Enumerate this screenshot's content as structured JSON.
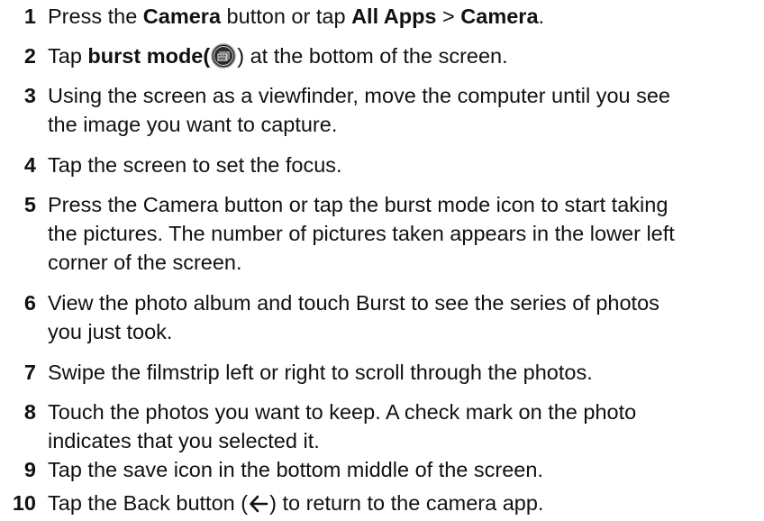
{
  "steps": [
    {
      "number": "1",
      "parts": {
        "a": "Press the ",
        "b": "Camera",
        "c": " button or tap ",
        "d": "All Apps",
        "e": " > ",
        "f": "Camera",
        "g": "."
      }
    },
    {
      "number": "2",
      "parts": {
        "a": "Tap ",
        "b": "burst mode",
        "c": "(",
        "d": ")",
        "e": " at the bottom of the screen."
      }
    },
    {
      "number": "3",
      "lines": [
        "Using the screen as a viewfinder, move the computer until you see",
        "the image you want to capture."
      ]
    },
    {
      "number": "4",
      "lines": [
        "Tap the screen to set the focus."
      ]
    },
    {
      "number": "5",
      "lines": [
        "Press the Camera button or tap the burst mode icon to start taking",
        "the pictures. The number of pictures taken appears in the lower left",
        "corner of the screen."
      ]
    },
    {
      "number": "6",
      "lines": [
        "View the photo album and touch Burst to see the series of photos",
        "you just took."
      ]
    },
    {
      "number": "7",
      "lines": [
        "Swipe the filmstrip left or right to scroll through the photos."
      ]
    },
    {
      "number": "8",
      "lines": [
        "Touch the photos you want to keep. A check mark on the photo",
        "indicates that you selected it."
      ]
    },
    {
      "number": "9",
      "lines": [
        "Tap the save icon in the bottom middle of the screen."
      ]
    },
    {
      "number": "10",
      "parts": {
        "a": "Tap the Back button (",
        "b": ") to return to the camera app."
      }
    }
  ],
  "icons": {
    "burst_mode": "burst-mode-icon",
    "back": "back-arrow-icon"
  }
}
